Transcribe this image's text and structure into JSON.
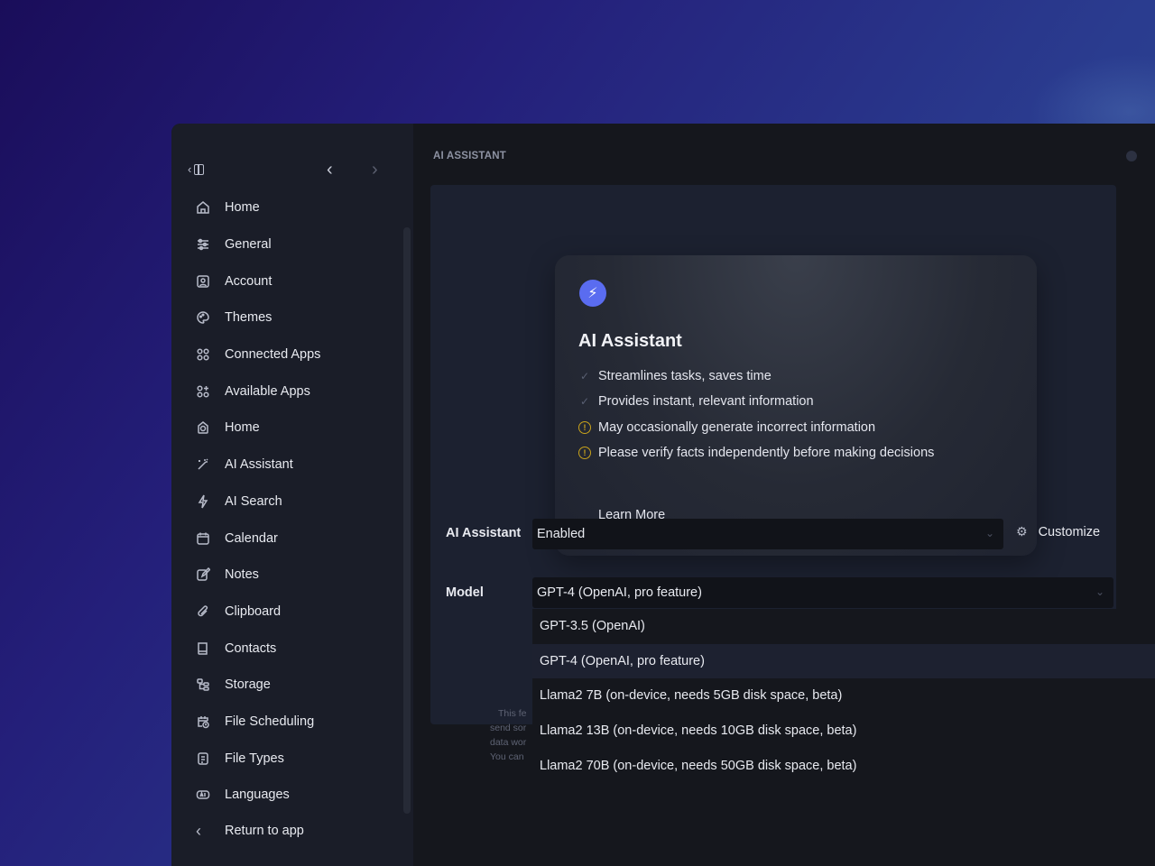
{
  "sidebar": {
    "items": [
      {
        "label": "Home",
        "icon": "home-icon"
      },
      {
        "label": "General",
        "icon": "sliders-icon"
      },
      {
        "label": "Account",
        "icon": "user-square-icon"
      },
      {
        "label": "Themes",
        "icon": "palette-icon"
      },
      {
        "label": "Connected Apps",
        "icon": "grid-icon"
      },
      {
        "label": "Available Apps",
        "icon": "grid-plus-icon"
      },
      {
        "label": "Home",
        "icon": "target-icon"
      },
      {
        "label": "AI Assistant",
        "icon": "magic-wand-icon"
      },
      {
        "label": "AI Search",
        "icon": "bolt-icon"
      },
      {
        "label": "Calendar",
        "icon": "calendar-icon"
      },
      {
        "label": "Notes",
        "icon": "note-edit-icon"
      },
      {
        "label": "Clipboard",
        "icon": "paperclip-icon"
      },
      {
        "label": "Contacts",
        "icon": "book-icon"
      },
      {
        "label": "Storage",
        "icon": "hierarchy-icon"
      },
      {
        "label": "File Scheduling",
        "icon": "calendar-clock-icon"
      },
      {
        "label": "File Types",
        "icon": "file-list-icon"
      },
      {
        "label": "Languages",
        "icon": "language-icon"
      }
    ],
    "return_label": "Return to app"
  },
  "main": {
    "section_title": "AI ASSISTANT",
    "card": {
      "title": "AI Assistant",
      "features": [
        {
          "text": "Streamlines tasks, saves time",
          "type": "check"
        },
        {
          "text": "Provides instant, relevant information",
          "type": "check"
        },
        {
          "text": "May occasionally generate incorrect information",
          "type": "warn"
        },
        {
          "text": "Please verify facts independently before making decisions",
          "type": "warn"
        }
      ],
      "learn_more": "Learn More"
    },
    "assistant_row": {
      "label": "AI Assistant",
      "value": "Enabled",
      "customize_label": "Customize"
    },
    "model_row": {
      "label": "Model",
      "value": "GPT-4 (OpenAI, pro feature)",
      "options": [
        "GPT-3.5 (OpenAI)",
        "GPT-4 (OpenAI, pro feature)",
        "Llama2 7B (on-device, needs 5GB disk space, beta)",
        "Llama2 13B (on-device, needs 10GB disk space, beta)",
        "Llama2 70B (on-device, needs 50GB disk space, beta)"
      ],
      "selected_index": 1
    },
    "description_fragments": [
      "This fe",
      "send sor",
      "data wor",
      "You can"
    ]
  },
  "colors": {
    "accent": "#5a6cf0",
    "warning": "#c9a31b",
    "sidebar_bg": "#1a1d28",
    "main_bg": "#15171d"
  }
}
